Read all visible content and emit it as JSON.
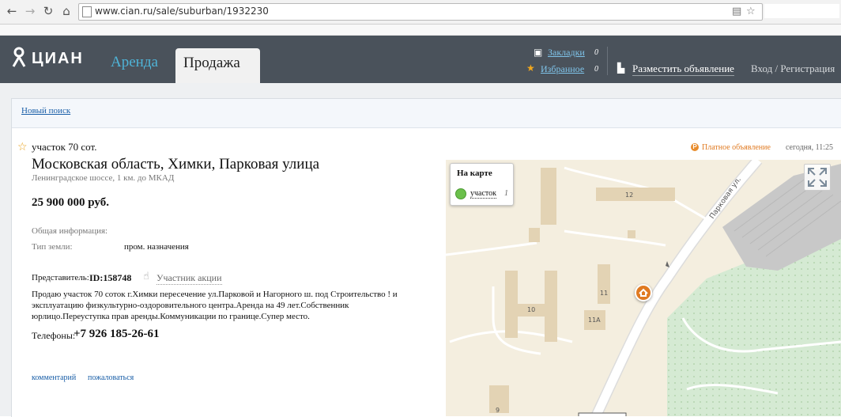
{
  "browser": {
    "url": "www.cian.ru/sale/suburban/1932230",
    "back_icon": "arrow-left-icon",
    "forward_icon": "arrow-right-icon",
    "reload_icon": "reload-icon",
    "home_icon": "home-icon"
  },
  "header": {
    "logo_text": "ЦИАН",
    "tabs": [
      {
        "label": "Аренда",
        "active": false
      },
      {
        "label": "Продажа",
        "active": true
      }
    ],
    "bookmarks_label": "Закладки",
    "bookmarks_count": "0",
    "favorites_label": "Избранное",
    "favorites_count": "0",
    "post_ad_label": "Разместить объявление",
    "login_label": "Вход / Регистрация",
    "colors": {
      "header_bg": "#4a525b",
      "link": "#7fc4ea",
      "rent_tab": "#4fb4d8"
    }
  },
  "search": {
    "new_search_label": "Новый поиск"
  },
  "listing": {
    "type_title": "участок 70 сот.",
    "paid_label": "Платное объявление",
    "date": "сегодня, 11:25",
    "address": "Московская область, Химки, Парковая улица",
    "highway": "Ленинградское шоссе, 1 км. до МКАД",
    "price": "25 900 000 руб.",
    "general_info_label": "Общая информация:",
    "land_type_label": "Тип земли:",
    "land_type_value": "пром. назначения",
    "representative_label": "Представитель:",
    "representative_id": "ID:158748",
    "promo_label": "Участник акции",
    "description": "Продаю участок 70 соток г.Химки пересечение ул.Парковой и Нагорного ш. под Строительство ! и эксплуатацию физкультурно-оздоровительного центра.Аренда на 49 лет.Собственник юрлицо.Переуступка прав аренды.Коммуникации по границе.Супер место.",
    "phones_label": "Телефоны:",
    "phone": "+7 926 185-26-61",
    "comment_label": "комментарий",
    "complain_label": "пожаловаться"
  },
  "map": {
    "legend_title": "На карте",
    "legend_item_label": "участок",
    "legend_item_count": "1",
    "street_label": "Парковая ул.",
    "building_labels": [
      "12",
      "11",
      "10",
      "11А",
      "9"
    ],
    "colors": {
      "land": "#f4eedf",
      "building": "#e3d3b4",
      "road": "#ffffff",
      "green": "#d5ead3",
      "industrial": "#c8c8c8"
    }
  }
}
